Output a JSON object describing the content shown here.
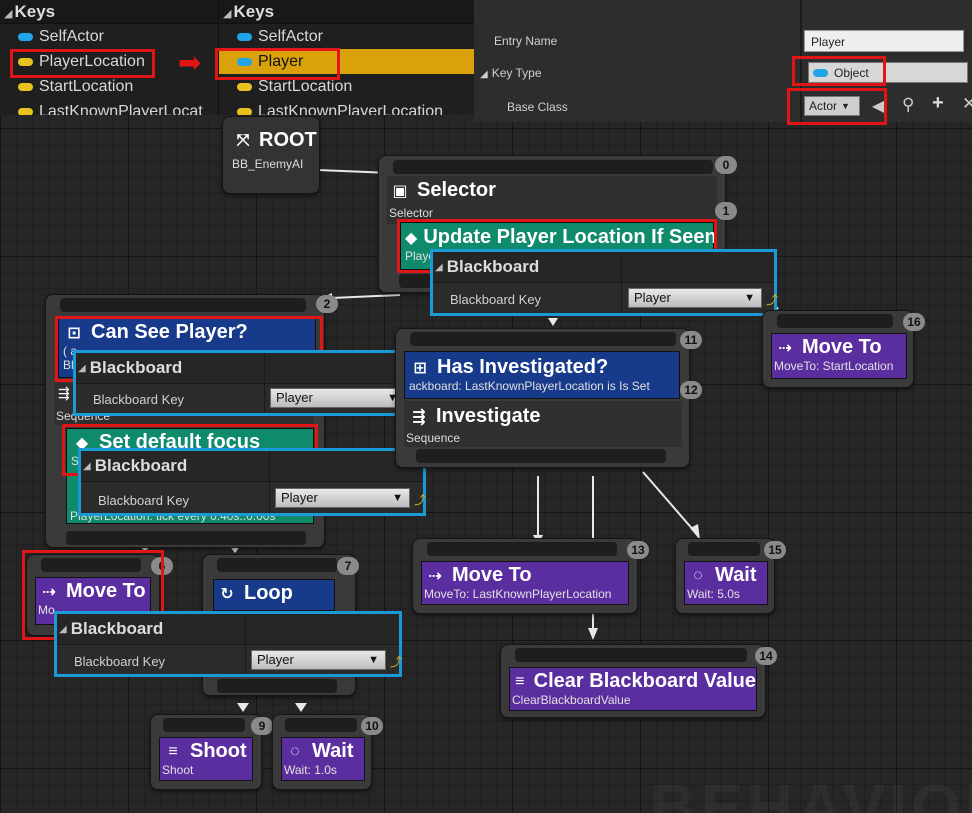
{
  "keys_left": {
    "header": "Keys",
    "items": [
      {
        "label": "SelfActor",
        "color": "blue"
      },
      {
        "label": "PlayerLocation",
        "color": "yellow"
      },
      {
        "label": "StartLocation",
        "color": "yellow"
      },
      {
        "label": "LastKnownPlayerLocat",
        "color": "yellow"
      }
    ]
  },
  "keys_right": {
    "header": "Keys",
    "items": [
      {
        "label": "SelfActor",
        "color": "blue"
      },
      {
        "label": "Player",
        "color": "blue"
      },
      {
        "label": "StartLocation",
        "color": "yellow"
      },
      {
        "label": "LastKnownPlayerLocation",
        "color": "yellow"
      }
    ]
  },
  "details": {
    "entry_name_label": "Entry Name",
    "entry_name_value": "Player",
    "key_type_label": "Key Type",
    "key_type_value": "Object",
    "base_class_label": "Base Class",
    "base_class_value": "Actor"
  },
  "nodes": {
    "root": {
      "title": "ROOT",
      "sub": "BB_EnemyAI"
    },
    "selector": {
      "title": "Selector",
      "sub": "Selector",
      "badge": "0",
      "badge2": "1"
    },
    "update_service": {
      "title": "Update Player Location If Seen",
      "sub": "Playe"
    },
    "can_see": {
      "title": "Can See Player?",
      "sub": "( a",
      "sub2": "Bla"
    },
    "sequence_left": {
      "sub": "Sequence",
      "badge": "2"
    },
    "set_focus": {
      "title": "Set default focus",
      "sub": "S",
      "footer": "PlayerLocation: tick every 0.40s..0.00s"
    },
    "has_investigated": {
      "title": "Has Investigated?",
      "sub": "ackboard: LastKnownPlayerLocation is Is Set",
      "badge": "11",
      "badge2": "12"
    },
    "investigate": {
      "title": "Investigate",
      "sub": "Sequence"
    },
    "move_to_start": {
      "title": "Move To",
      "sub": "MoveTo: StartLocation",
      "badge": "16"
    },
    "move_to_player": {
      "title": "Move To",
      "sub": "Mo",
      "badge": "6"
    },
    "loop": {
      "title": "Loop",
      "badge": "7"
    },
    "move_to_last": {
      "title": "Move To",
      "sub": "MoveTo: LastKnownPlayerLocation",
      "badge": "13"
    },
    "wait_5": {
      "title": "Wait",
      "sub": "Wait: 5.0s",
      "badge": "15"
    },
    "clear_bb": {
      "title": "Clear Blackboard Value",
      "sub": "ClearBlackboardValue",
      "badge": "14"
    },
    "shoot": {
      "title": "Shoot",
      "sub": "Shoot",
      "badge": "9"
    },
    "wait_1": {
      "title": "Wait",
      "sub": "Wait: 1.0s",
      "badge": "10"
    }
  },
  "blackboard_popups": {
    "header": "Blackboard",
    "key_label": "Blackboard Key",
    "value": "Player"
  },
  "watermark": "BEHAVIOR",
  "colors": {
    "highlight_red": "#e01515",
    "highlight_blue": "#1a9ad6",
    "task_purple": "#5b2ea0",
    "decorator_blue": "#173a8a",
    "service_teal": "#0f8a6a",
    "selected_key": "#d9a20a"
  }
}
